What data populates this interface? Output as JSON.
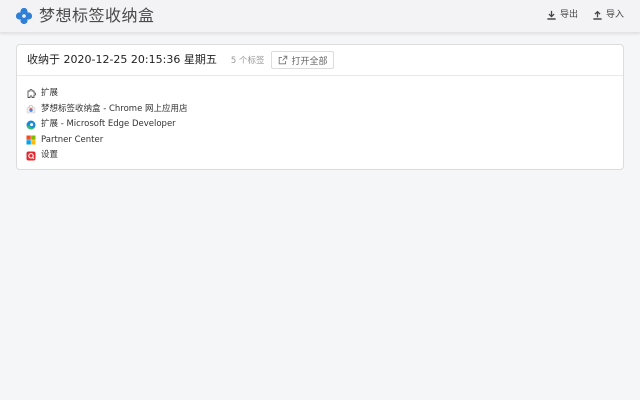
{
  "header": {
    "title": "梦想标签收纳盒",
    "brand_color": "#2f7fd6",
    "icon": "clover-icon",
    "actions": [
      {
        "label": "导出",
        "icon": "download-icon"
      },
      {
        "label": "导入",
        "icon": "upload-icon"
      }
    ]
  },
  "group": {
    "title": "收纳于 2020-12-25 20:15:36 星期五",
    "tab_count": "5 个标签",
    "open_all_label": "打开全部",
    "open_all_icon": "external-link-icon",
    "tabs": [
      {
        "title": "扩展",
        "favicon": "chrome-extension-icon"
      },
      {
        "title": "梦想标签收纳盒 - Chrome 网上应用店",
        "favicon": "chrome-web-store-icon"
      },
      {
        "title": "扩展 - Microsoft Edge Developer",
        "favicon": "edge-icon"
      },
      {
        "title": "Partner Center",
        "favicon": "microsoft-logo-icon"
      },
      {
        "title": "设置",
        "favicon": "settings-red-icon"
      }
    ]
  }
}
